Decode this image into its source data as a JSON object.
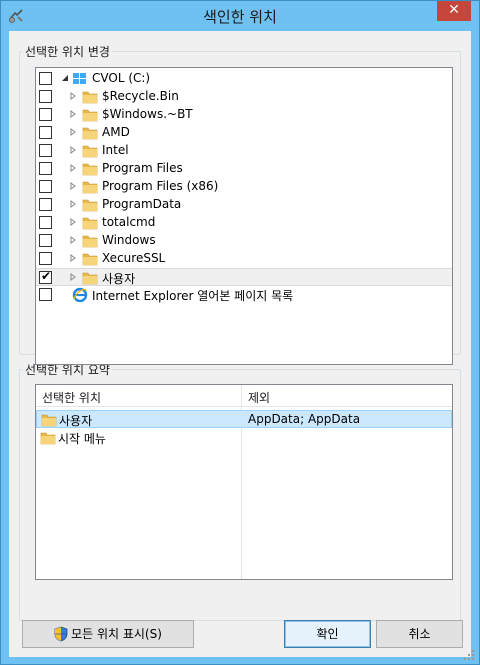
{
  "window": {
    "title": "색인한 위치",
    "close_symbol": "✕"
  },
  "change_group": {
    "legend": "선택한 위치 변경",
    "items": [
      {
        "label": "CVOL (C:)",
        "checked": false,
        "icon": "drive-icon",
        "expander": "expanded"
      },
      {
        "label": "$Recycle.Bin",
        "checked": false,
        "icon": "folder-icon"
      },
      {
        "label": "$Windows.~BT",
        "checked": false,
        "icon": "folder-icon"
      },
      {
        "label": "AMD",
        "checked": false,
        "icon": "folder-icon"
      },
      {
        "label": "Intel",
        "checked": false,
        "icon": "folder-icon"
      },
      {
        "label": "Program Files",
        "checked": false,
        "icon": "folder-icon"
      },
      {
        "label": "Program Files (x86)",
        "checked": false,
        "icon": "folder-icon"
      },
      {
        "label": "ProgramData",
        "checked": false,
        "icon": "folder-icon"
      },
      {
        "label": "totalcmd",
        "checked": false,
        "icon": "folder-icon"
      },
      {
        "label": "Windows",
        "checked": false,
        "icon": "folder-icon"
      },
      {
        "label": "XecureSSL",
        "checked": false,
        "icon": "folder-icon"
      },
      {
        "label": "사용자",
        "checked": true,
        "icon": "folder-icon"
      },
      {
        "label": "Internet Explorer 열어본 페이지 목록",
        "checked": false,
        "icon": "ie-icon"
      }
    ]
  },
  "summary_group": {
    "legend": "선택한 위치 요약",
    "columns": [
      "선택한 위치",
      "제외"
    ],
    "rows": [
      {
        "location": "사용자",
        "exclude": "AppData; AppData"
      },
      {
        "location": "시작 메뉴",
        "exclude": ""
      }
    ]
  },
  "buttons": {
    "show_all": "모든 위치 표시(S)",
    "ok": "확인",
    "cancel": "취소"
  },
  "colors": {
    "titlebar": "#6ec1f0",
    "close": "#c7463c",
    "folder": "#e8b84a",
    "selection": "#cce8ff"
  }
}
